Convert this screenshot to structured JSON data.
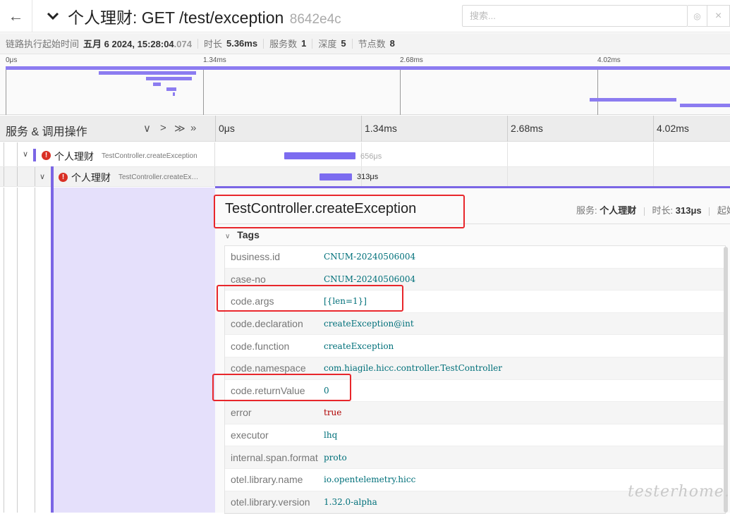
{
  "header": {
    "back_icon": "arrow-left-icon",
    "title": "个人理财: GET /test/exception",
    "trace_id": "8642e4c",
    "search_placeholder": "搜索...",
    "locate_icon": "target-icon",
    "close_icon": "close-icon"
  },
  "summary": {
    "start_label": "链路执行起始时间",
    "start_value": "五月 6 2024, 15:28:04",
    "start_ms": ".074",
    "duration_label": "时长",
    "duration_value": "5.36ms",
    "services_label": "服务数",
    "services_value": "1",
    "depth_label": "深度",
    "depth_value": "5",
    "spans_label": "节点数",
    "spans_value": "8"
  },
  "minimap": {
    "ticks": [
      "0μs",
      "1.34ms",
      "2.68ms",
      "4.02ms"
    ]
  },
  "timeline": {
    "left_title": "服务 & 调用操作",
    "nav_icons": [
      "chevron-down-icon",
      "chevron-right-icon",
      "double-chevron-down-icon",
      "double-chevron-right-icon"
    ],
    "nav_glyphs": [
      "∨",
      ">",
      "≫",
      "»"
    ],
    "ticks": [
      "0μs",
      "1.34ms",
      "2.68ms",
      "4.02ms"
    ]
  },
  "spans": [
    {
      "service": "个人理财",
      "operation": "TestController.createException",
      "duration": "656μs",
      "error": true,
      "error_glyph": "!"
    },
    {
      "service": "个人理财",
      "operation": "TestController.createEx…",
      "duration": "313μs",
      "error": true,
      "error_glyph": "!"
    }
  ],
  "detail": {
    "title": "TestController.createException",
    "service_label": "服务:",
    "service_value": "个人理财",
    "duration_label": "时长:",
    "duration_value": "313μs",
    "start_label": "起始",
    "tags_label": "Tags",
    "tags": [
      {
        "key": "business.id",
        "value": "CNUM-20240506004"
      },
      {
        "key": "case-no",
        "value": "CNUM-20240506004"
      },
      {
        "key": "code.args",
        "value": "[{len=1}]"
      },
      {
        "key": "code.declaration",
        "value": "createException@int"
      },
      {
        "key": "code.function",
        "value": "createException"
      },
      {
        "key": "code.namespace",
        "value": "com.hiagile.hicc.controller.TestController"
      },
      {
        "key": "code.returnValue",
        "value": "0"
      },
      {
        "key": "error",
        "value": "true"
      },
      {
        "key": "executor",
        "value": "lhq"
      },
      {
        "key": "internal.span.format",
        "value": "proto"
      },
      {
        "key": "otel.library.name",
        "value": "io.opentelemetry.hicc"
      },
      {
        "key": "otel.library.version",
        "value": "1.32.0-alpha"
      }
    ]
  },
  "colors": {
    "span_bar": "#7c6cf0",
    "service_accent": "#7b66e5",
    "error": "#d93025",
    "highlight": "#e8262b",
    "tag_value": "#00707a"
  },
  "watermark": "testerhome.com"
}
